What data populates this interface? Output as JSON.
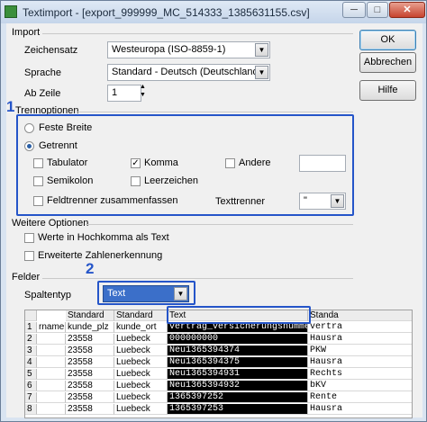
{
  "window": {
    "title": "Textimport - [export_999999_MC_514333_1385631155.csv]",
    "minimize": "─",
    "maximize": "□",
    "close": "✕"
  },
  "buttons": {
    "ok": "OK",
    "cancel": "Abbrechen",
    "help": "Hilfe"
  },
  "import": {
    "group": "Import",
    "charset_label": "Zeichensatz",
    "charset": "Westeuropa (ISO-8859-1)",
    "language_label": "Sprache",
    "language": "Standard - Deutsch (Deutschland)",
    "from_row_label": "Ab Zeile",
    "from_row": "1"
  },
  "separator": {
    "group": "Trennoptionen",
    "fixed": "Feste Breite",
    "separated": "Getrennt",
    "tab": "Tabulator",
    "comma": "Komma",
    "other": "Andere",
    "semicolon": "Semikolon",
    "space": "Leerzeichen",
    "merge": "Feldtrenner zusammenfassen",
    "text_delim_label": "Texttrenner",
    "text_delim": "\"",
    "comma_mark": "✓"
  },
  "other_options": {
    "group": "Weitere Optionen",
    "quoted_as_text": "Werte in Hochkomma als Text",
    "detect_special": "Erweiterte Zahlenerkennung"
  },
  "fields": {
    "group": "Felder",
    "column_type_label": "Spaltentyp",
    "column_type": "Text"
  },
  "annotations": {
    "one": "1",
    "two": "2"
  },
  "preview": {
    "headers": [
      "",
      "Standard",
      "Standard",
      "Text",
      "Standa"
    ],
    "rows": [
      [
        "1",
        "rname",
        "kunde_plz",
        "kunde_ort",
        "vertrag_versicherungsnummer",
        "vertra"
      ],
      [
        "2",
        "",
        "23558",
        "Luebeck",
        "000000000",
        "Hausra"
      ],
      [
        "3",
        "",
        "23558",
        "Luebeck",
        "Neu1365394374",
        "PKW"
      ],
      [
        "4",
        "",
        "23558",
        "Luebeck",
        "Neu1365394375",
        "Hausra"
      ],
      [
        "5",
        "",
        "23558",
        "Luebeck",
        "Neu1365394931",
        "Rechts"
      ],
      [
        "6",
        "",
        "23558",
        "Luebeck",
        "Neu1365394932",
        "bKV"
      ],
      [
        "7",
        "",
        "23558",
        "Luebeck",
        "1365397252",
        "Rente"
      ],
      [
        "8",
        "",
        "23558",
        "Luebeck",
        "1365397253",
        "Hausra"
      ]
    ]
  }
}
